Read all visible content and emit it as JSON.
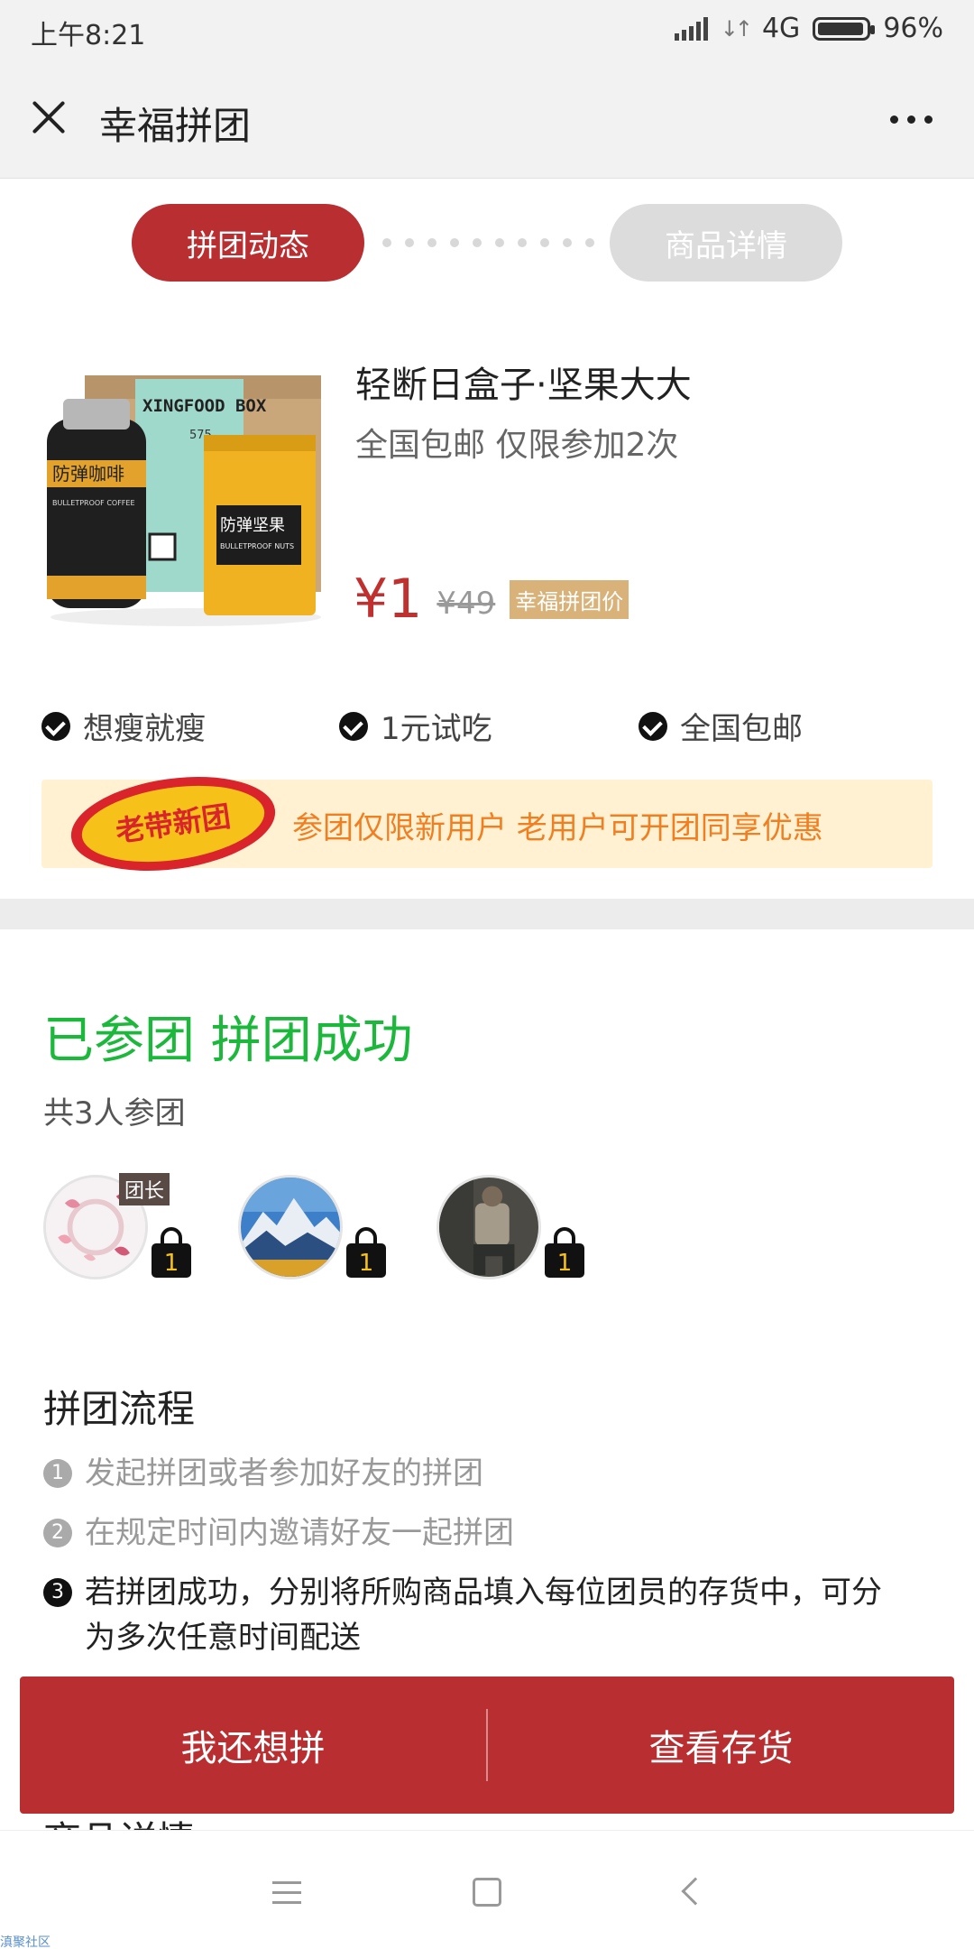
{
  "status_bar": {
    "time": "上午8:21",
    "network": "4G",
    "battery": "96%",
    "battery_level": 0.96
  },
  "nav": {
    "title": "幸福拼团"
  },
  "tabs": [
    {
      "label": "拼团动态",
      "active": true
    },
    {
      "label": "商品详情",
      "active": false
    }
  ],
  "product": {
    "title": "轻断日盒子·坚果大大",
    "subtitle": "全国包邮 仅限参加2次",
    "price": "¥1",
    "original_price": "¥49",
    "price_badge": "幸福拼团价",
    "image": {
      "box_text": "XINGFOOD BOX",
      "box_number": "575",
      "bottle_label": "防弹咖啡",
      "bottle_sub": "BULLETPROOF COFFEE",
      "bag_label": "防弹坚果",
      "bag_sub": "BULLETPROOF NUTS"
    }
  },
  "features": [
    "想瘦就瘦",
    "1元试吃",
    "全国包邮"
  ],
  "promo": {
    "badge": "老带新团",
    "text": "参团仅限新用户 老用户可开团同享优惠"
  },
  "group": {
    "status": "已参团 拼团成功",
    "count": "共3人参团",
    "leader_label": "团长",
    "members": [
      {
        "bag_count": "1"
      },
      {
        "bag_count": "1"
      },
      {
        "bag_count": "1"
      }
    ]
  },
  "process": {
    "title": "拼团流程",
    "steps": [
      {
        "num": "1",
        "text": "发起拼团或者参加好友的拼团"
      },
      {
        "num": "2",
        "text": "在规定时间内邀请好友一起拼团"
      },
      {
        "num": "3",
        "text": "若拼团成功，分别将所购商品填入每位团员的存货中，可分为多次任意时间配送"
      }
    ]
  },
  "actions": {
    "again": "我还想拼",
    "inventory": "查看存货"
  },
  "peek_section": "商品详情",
  "watermark": "滇聚社区",
  "colors": {
    "brand_red": "#b82e31",
    "success_green": "#1cb83c",
    "promo_orange": "#f07f22",
    "promo_bg": "#fff1d2"
  }
}
